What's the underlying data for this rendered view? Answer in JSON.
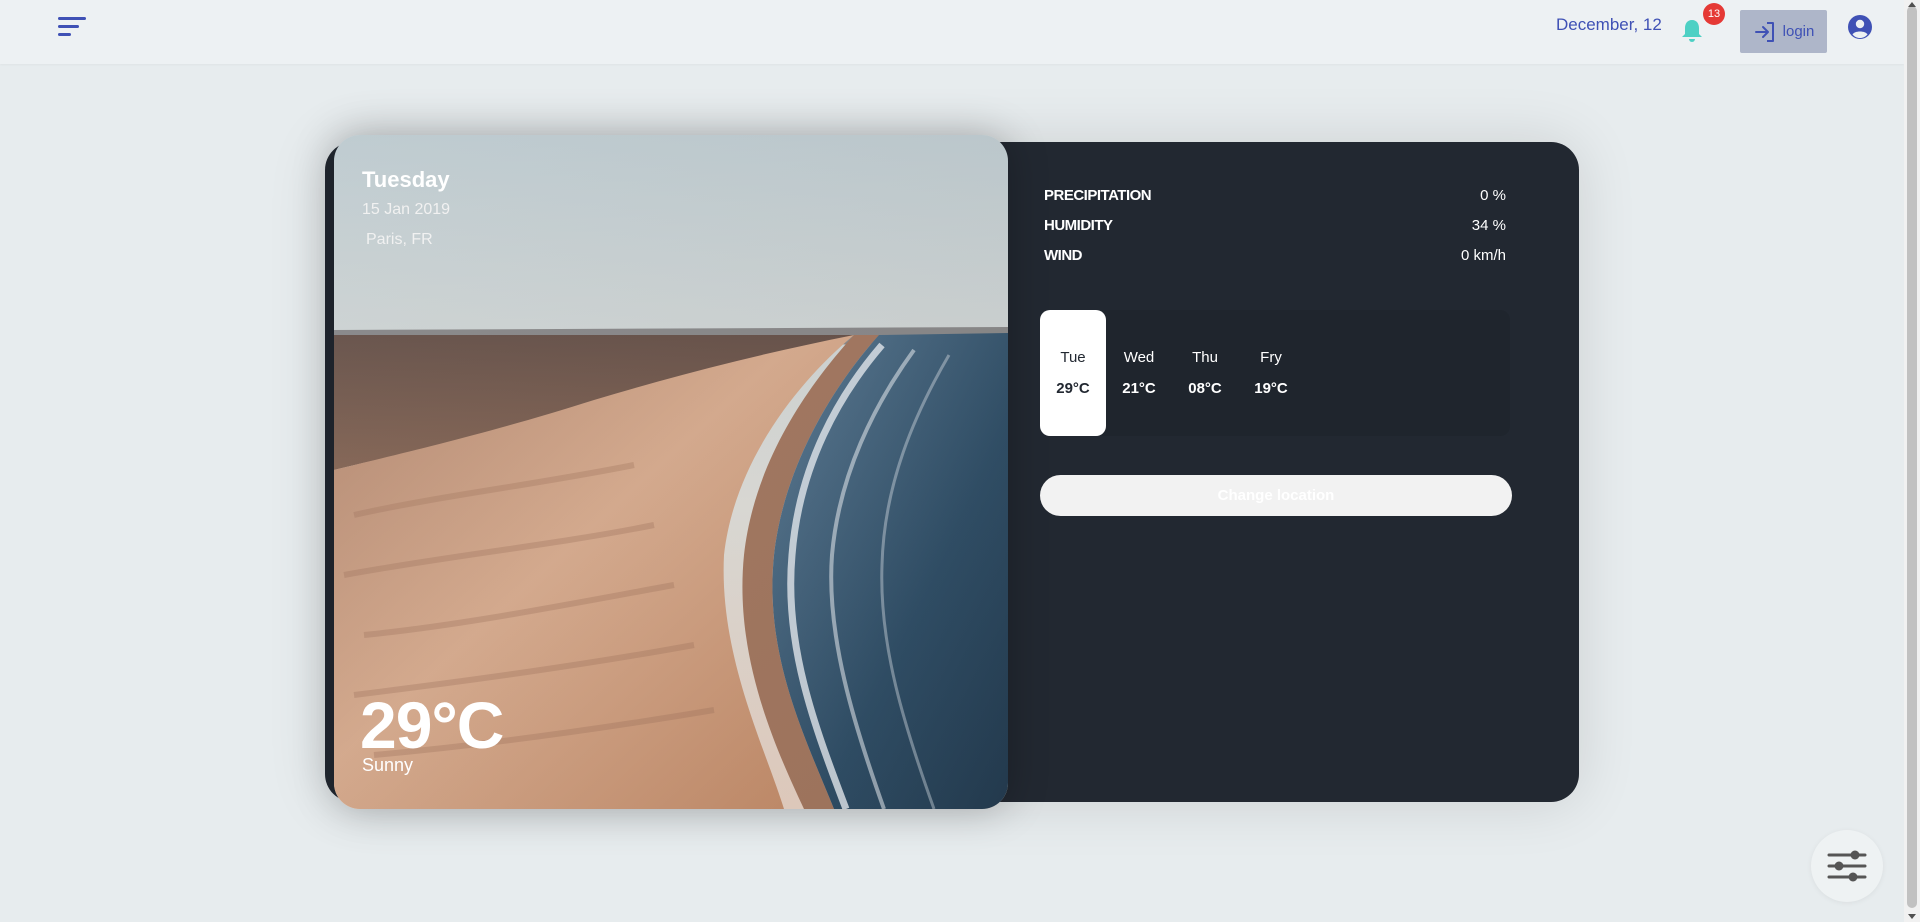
{
  "header": {
    "date": "December, 12",
    "notification_count": "13",
    "login_label": "login"
  },
  "weather": {
    "day": "Tuesday",
    "date": "15 Jan 2019",
    "location": "Paris, FR",
    "temperature": "29°C",
    "condition": "Sunny"
  },
  "stats": [
    {
      "label": "PRECIPITATION",
      "value": "0 %"
    },
    {
      "label": "HUMIDITY",
      "value": "34 %"
    },
    {
      "label": "WIND",
      "value": "0 km/h"
    }
  ],
  "forecast": [
    {
      "day": "Tue",
      "temp": "29°C",
      "active": true
    },
    {
      "day": "Wed",
      "temp": "21°C",
      "active": false
    },
    {
      "day": "Thu",
      "temp": "08°C",
      "active": false
    },
    {
      "day": "Fry",
      "temp": "19°C",
      "active": false
    }
  ],
  "change_location_label": "Change location",
  "colors": {
    "accent": "#3f51b5",
    "card": "#222831",
    "badge": "#e53935",
    "bell": "#4dd0c4"
  },
  "icons": {
    "menu": "menu-icon",
    "bell": "bell-icon",
    "login": "login-icon",
    "account": "account-circle-icon",
    "location": "location-pin-icon",
    "settings": "sliders-icon"
  }
}
